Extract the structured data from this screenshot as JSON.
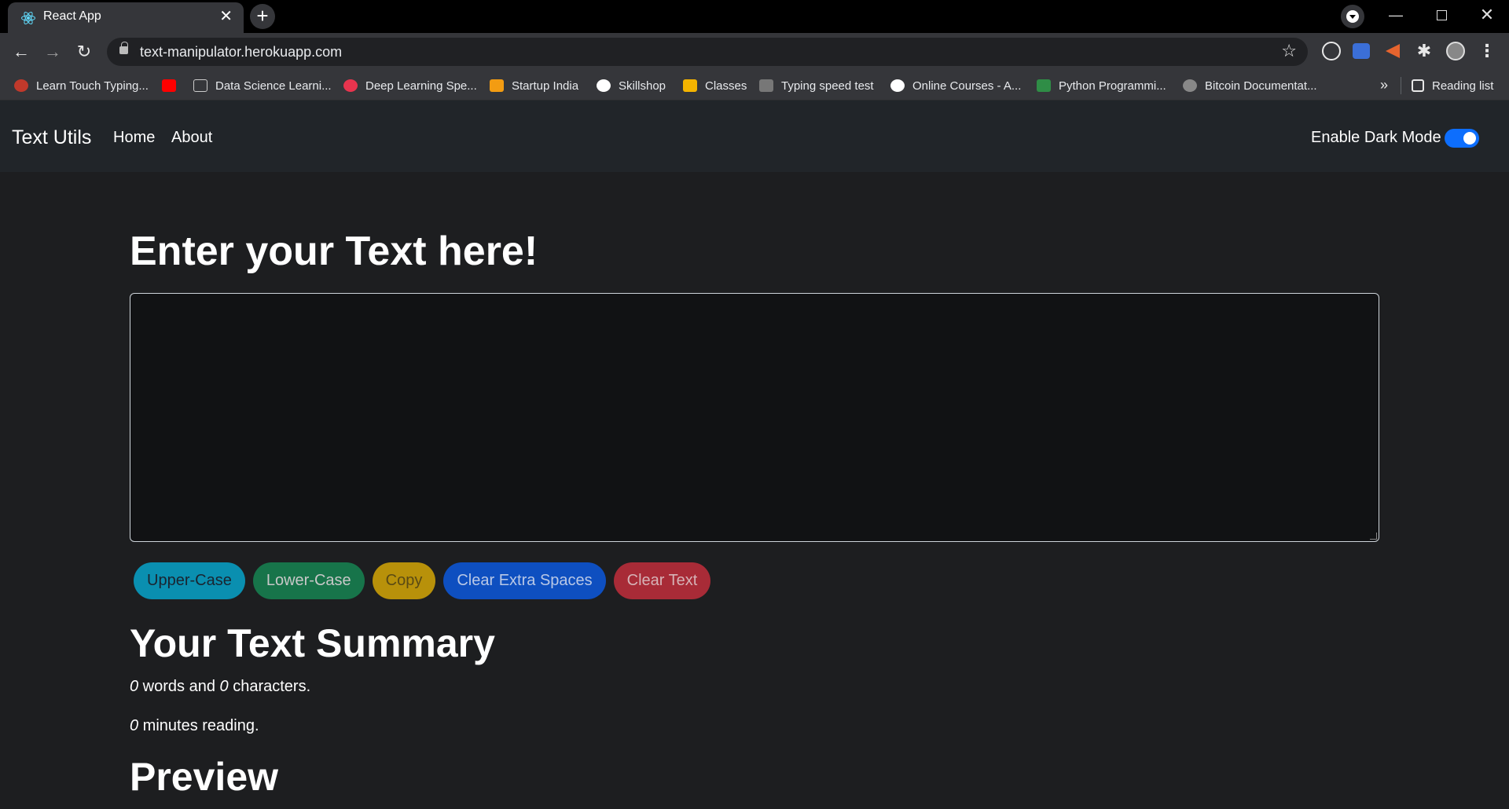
{
  "browser": {
    "tab_title": "React App",
    "tab_close": "✕",
    "new_tab": "+",
    "url": "text-manipulator.herokuapp.com",
    "bookmarks": [
      {
        "label": "Learn Touch Typing...",
        "color": "#c0392b"
      },
      {
        "label": "",
        "color": "#ff0000"
      },
      {
        "label": "Data Science Learni...",
        "color": "#1d1e20"
      },
      {
        "label": "Deep Learning Spe...",
        "color": "#e8344e"
      },
      {
        "label": "Startup India",
        "color": "#f39c12"
      },
      {
        "label": "Skillshop",
        "color": "#4285f4"
      },
      {
        "label": "Classes",
        "color": "#f4b400"
      },
      {
        "label": "Typing speed test",
        "color": "#777777"
      },
      {
        "label": "Online Courses - A...",
        "color": "#ffffff"
      },
      {
        "label": "Python Programmi...",
        "color": "#2f8d46"
      },
      {
        "label": "Bitcoin Documentat...",
        "color": "#888888"
      }
    ],
    "more": "»",
    "reading_list": "Reading list"
  },
  "navbar": {
    "brand": "Text Utils",
    "links": [
      "Home",
      "About"
    ],
    "dark_mode_label": "Enable Dark Mode",
    "dark_mode_enabled": true
  },
  "main": {
    "heading": "Enter your Text here!",
    "textarea_value": "",
    "buttons": [
      "Upper-Case",
      "Lower-Case",
      "Copy",
      "Clear Extra Spaces",
      "Clear Text"
    ],
    "summary_heading": "Your Text Summary",
    "word_count": "0",
    "words_text": " words and ",
    "char_count": "0",
    "chars_text": " characters.",
    "minutes": "0",
    "minutes_text": " minutes reading.",
    "preview_heading": "Preview"
  },
  "colors": {
    "accent": "#0d6efd",
    "background": "#1d1e20",
    "navbar": "#212529"
  }
}
